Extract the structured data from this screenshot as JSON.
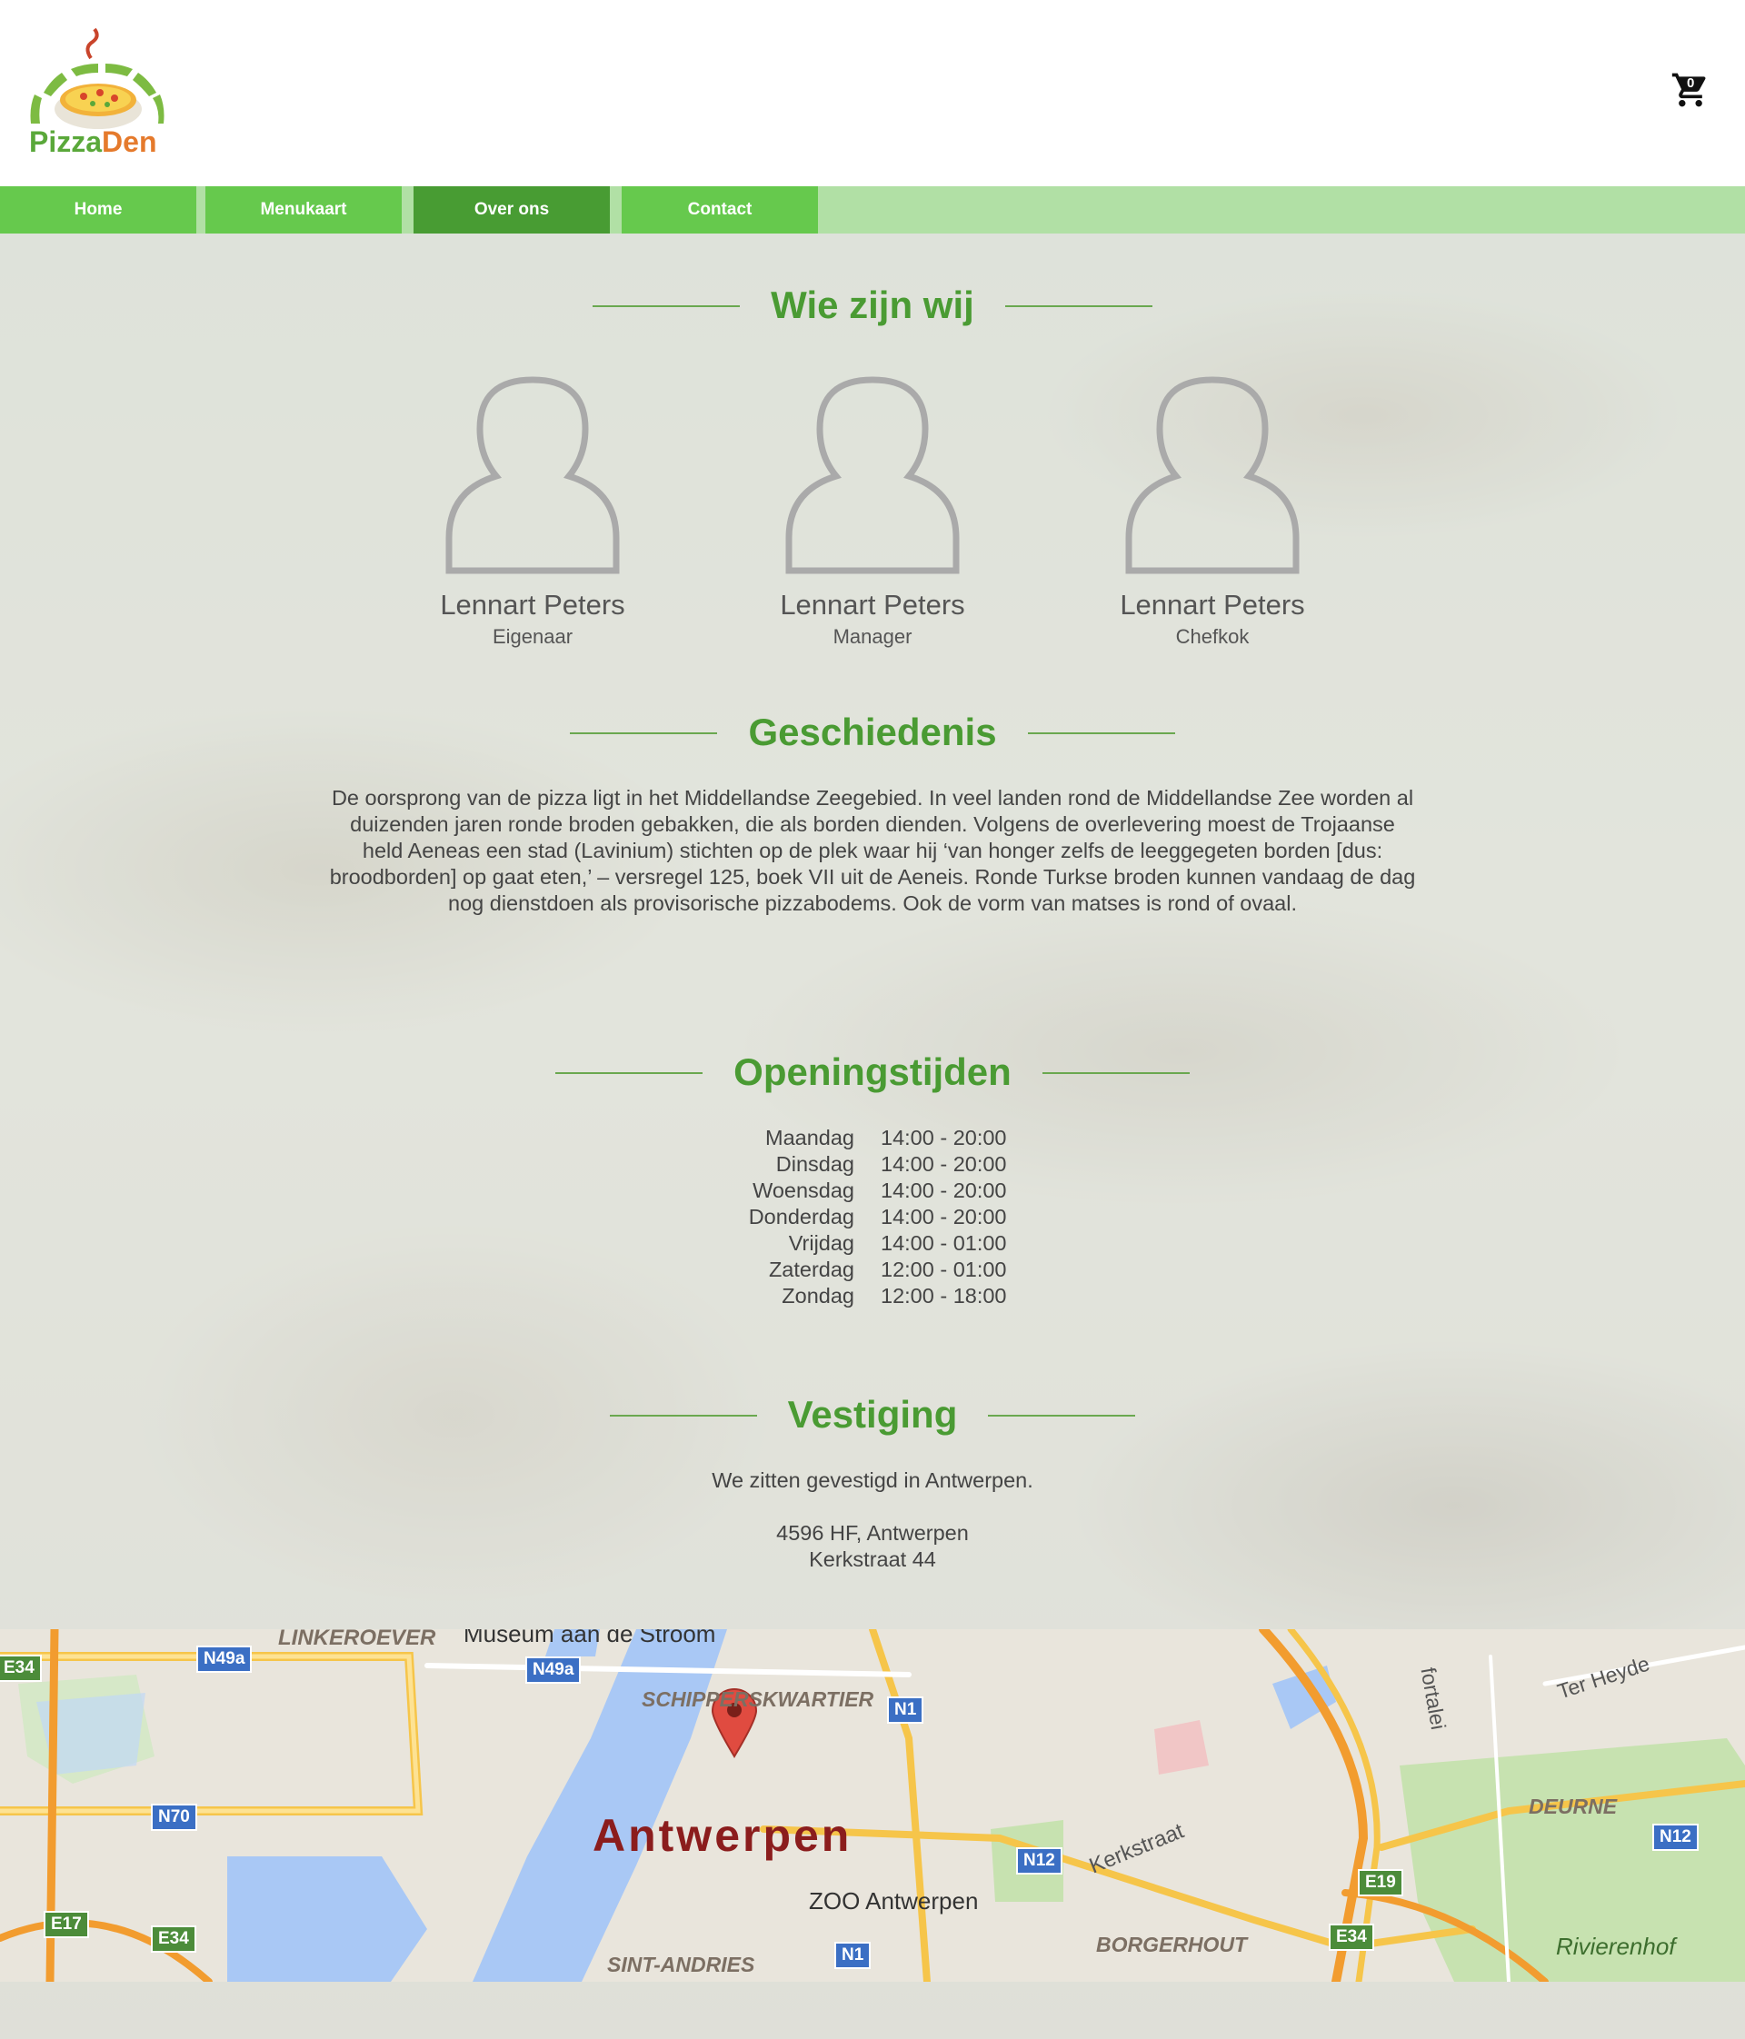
{
  "brand": {
    "name_part1": "Pizza",
    "name_part2": "Den"
  },
  "cart": {
    "count": "0"
  },
  "nav": {
    "items": [
      {
        "label": "Home"
      },
      {
        "label": "Menukaart"
      },
      {
        "label": "Over ons",
        "active": true
      },
      {
        "label": "Contact"
      }
    ]
  },
  "about": {
    "title": "Wie zijn wij",
    "people": [
      {
        "name": "Lennart Peters",
        "role": "Eigenaar"
      },
      {
        "name": "Lennart Peters",
        "role": "Manager"
      },
      {
        "name": "Lennart Peters",
        "role": "Chefkok"
      }
    ]
  },
  "history": {
    "title": "Geschiedenis",
    "text": "De oorsprong van de pizza ligt in het Middellandse Zeegebied. In veel landen rond de Middellandse Zee worden al duizenden jaren ronde broden gebakken, die als borden dienden. Volgens de overlevering moest de Trojaanse held Aeneas een stad (Lavinium) stichten op de plek waar hij ‘van honger zelfs de leeggegeten borden [dus: broodborden] op gaat eten,’ – versregel 125, boek VII uit de Aeneis. Ronde Turkse broden kunnen vandaag de dag nog dienstdoen als provisorische pizzabodems. Ook de vorm van matses is rond of ovaal."
  },
  "hours": {
    "title": "Openingstijden",
    "rows": [
      {
        "day": "Maandag",
        "time": "14:00 - 20:00"
      },
      {
        "day": "Dinsdag",
        "time": "14:00 - 20:00"
      },
      {
        "day": "Woensdag",
        "time": "14:00 - 20:00"
      },
      {
        "day": "Donderdag",
        "time": "14:00 - 20:00"
      },
      {
        "day": "Vrijdag",
        "time": "14:00 - 01:00"
      },
      {
        "day": "Zaterdag",
        "time": "12:00 - 01:00"
      },
      {
        "day": "Zondag",
        "time": "12:00 - 18:00"
      }
    ]
  },
  "location": {
    "title": "Vestiging",
    "intro": "We zitten gevestigd in Antwerpen.",
    "line1": "4596 HF, Antwerpen",
    "line2": "Kerkstraat 44"
  },
  "map": {
    "city": "Antwerpen",
    "labels": {
      "linkeroever": "LINKEROEVER",
      "museum": "Museum aan de Stroom",
      "schipperskwartier": "SCHIPPERSKWARTIER",
      "zoo": "ZOO Antwerpen",
      "sint_andries": "SINT-ANDRIES",
      "borgerhout": "BORGERHOUT",
      "deurne": "DEURNE",
      "rivierenhof": "Rivierenhof",
      "kerkstraat": "Kerkstraat",
      "fortalei": "fortalei",
      "ter_heyde": "Ter Heyde"
    },
    "badges": [
      "E34",
      "N49a",
      "N49a",
      "N1",
      "N70",
      "N12",
      "E19",
      "N12",
      "E17",
      "E34",
      "N1",
      "E34"
    ]
  },
  "colors": {
    "accent": "#4a9b33",
    "nav": "#66c94d",
    "nav_active": "#489c33",
    "nav_bar": "#b1e0a5"
  }
}
